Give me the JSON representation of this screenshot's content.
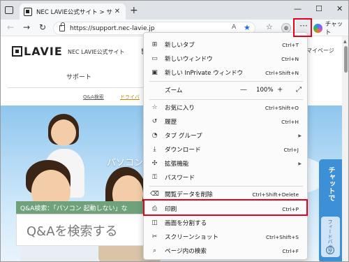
{
  "browser": {
    "tab_title": "NEC LAVIE公式サイト > サービス＆サ",
    "url": "https://support.nec-lavie.jp",
    "read_aloud_label": "A",
    "copilot_label": "チャット",
    "icons": {
      "back": "back-arrow-icon",
      "forward": "forward-arrow-icon",
      "refresh": "refresh-icon",
      "favorite": "star-icon",
      "collections": "collections-icon",
      "profile": "profile-icon",
      "more": "more-icon"
    }
  },
  "page": {
    "logo_text": "LAVIE",
    "site_name": "NEC LAVIE公式サイト",
    "nav_fragment": "製",
    "mypage": "マイページ",
    "support": "サポート",
    "qa_link": "Q&A検索",
    "driver_link": "ドライバ",
    "hero_text": "パソコン",
    "qa_tag": "Q&A検索：「パソコン 起動しない」な",
    "qa_search_placeholder": "Q&Aを検索する",
    "chat_label": "チャットで",
    "feedback_label": "フィードバック"
  },
  "menu": {
    "items": [
      {
        "icon": "new-tab-icon",
        "label": "新しいタブ",
        "shortcut": "Ctrl+T"
      },
      {
        "icon": "new-window-icon",
        "label": "新しいウィンドウ",
        "shortcut": "Ctrl+N"
      },
      {
        "icon": "inprivate-icon",
        "label": "新しい InPrivate ウィンドウ",
        "shortcut": "Ctrl+Shift+N"
      },
      {
        "icon": "zoom-icon",
        "label": "ズーム",
        "zoom_value": "100%"
      },
      {
        "icon": "favorites-icon",
        "label": "お気に入り",
        "shortcut": "Ctrl+Shift+O"
      },
      {
        "icon": "history-icon",
        "label": "履歴",
        "shortcut": "Ctrl+H"
      },
      {
        "icon": "tab-groups-icon",
        "label": "タブ グループ",
        "shortcut": ""
      },
      {
        "icon": "downloads-icon",
        "label": "ダウンロード",
        "shortcut": "Ctrl+J"
      },
      {
        "icon": "extensions-icon",
        "label": "拡張機能",
        "shortcut": ""
      },
      {
        "icon": "passwords-icon",
        "label": "パスワード",
        "shortcut": ""
      },
      {
        "icon": "clear-data-icon",
        "label": "閲覧データを削除",
        "shortcut": "Ctrl+Shift+Delete"
      },
      {
        "icon": "print-icon",
        "label": "印刷",
        "shortcut": "Ctrl+P"
      },
      {
        "icon": "split-screen-icon",
        "label": "画面を分割する",
        "shortcut": ""
      },
      {
        "icon": "screenshot-icon",
        "label": "スクリーンショット",
        "shortcut": "Ctrl+Shift+S"
      },
      {
        "icon": "find-icon",
        "label": "ページ内の検索",
        "shortcut": "Ctrl+F"
      }
    ]
  },
  "accent": {
    "highlight": "#e8001c",
    "edge_blue": "#1e6fe0",
    "chat_blue": "#3d8fd6",
    "qa_green": "#6fa27b"
  }
}
